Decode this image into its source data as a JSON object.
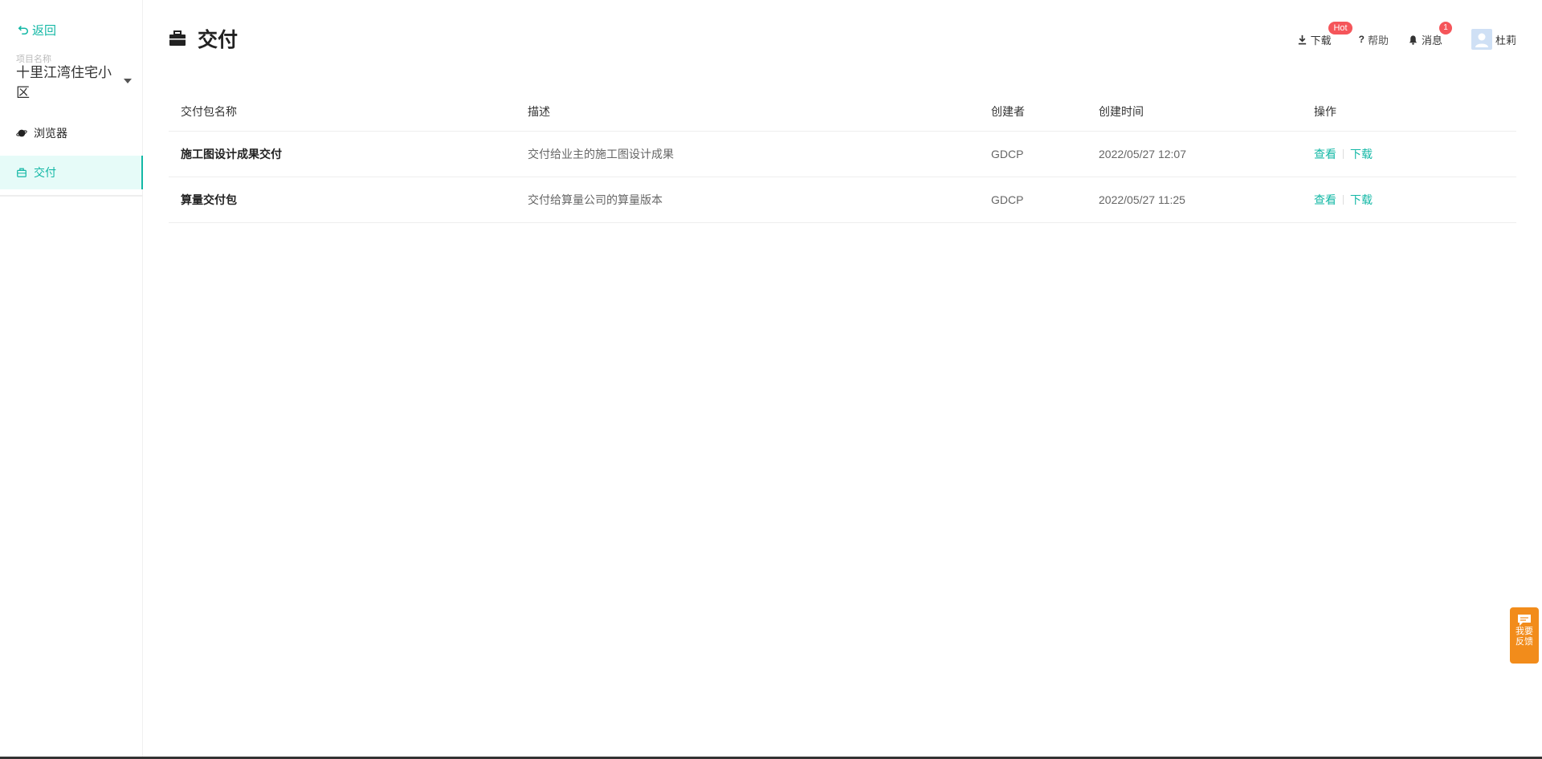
{
  "sidebar": {
    "back_label": "返回",
    "project_label": "项目名称",
    "project_name": "十里江湾住宅小区",
    "items": [
      {
        "label": "浏览器",
        "icon": "planet-icon",
        "active": false
      },
      {
        "label": "交付",
        "icon": "briefcase-icon",
        "active": true
      }
    ]
  },
  "header": {
    "title": "交付",
    "download_label": "下载",
    "download_badge": "Hot",
    "help_label": "帮助",
    "messages_label": "消息",
    "messages_count": "1",
    "user_name": "杜莉"
  },
  "table": {
    "columns": [
      "交付包名称",
      "描述",
      "创建者",
      "创建时间",
      "操作"
    ],
    "rows": [
      {
        "name": "施工图设计成果交付",
        "desc": "交付给业主的施工图设计成果",
        "creator": "GDCP",
        "time": "2022/05/27 12:07",
        "view": "查看",
        "download": "下载"
      },
      {
        "name": "算量交付包",
        "desc": "交付给算量公司的算量版本",
        "creator": "GDCP",
        "time": "2022/05/27 11:25",
        "view": "查看",
        "download": "下载"
      }
    ]
  },
  "feedback": {
    "label": "我要反馈"
  },
  "colors": {
    "accent": "#14b8a6",
    "badge": "#f5555a",
    "feedback": "#f28c1b"
  }
}
